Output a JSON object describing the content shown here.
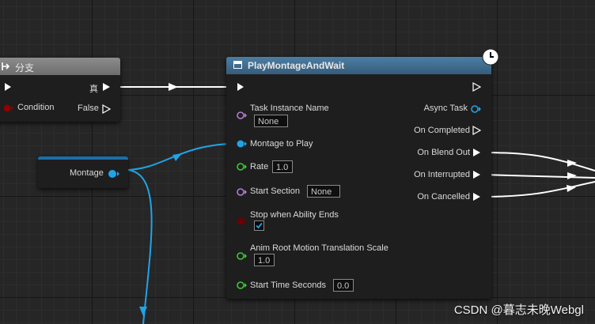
{
  "branch_node": {
    "title": "分支",
    "exec_out_true": "真",
    "condition_label": "Condition",
    "false_label": "False"
  },
  "variable_node": {
    "label": "Montage"
  },
  "play_node": {
    "title": "PlayMontageAndWait",
    "inputs": {
      "task_instance_name": {
        "label": "Task Instance Name",
        "value": "None"
      },
      "montage_to_play": {
        "label": "Montage to Play"
      },
      "rate": {
        "label": "Rate",
        "value": "1.0"
      },
      "start_section": {
        "label": "Start Section",
        "value": "None"
      },
      "stop_when_ability_ends": {
        "label": "Stop when Ability Ends",
        "checked": true
      },
      "anim_root_motion": {
        "label": "Anim Root Motion Translation Scale",
        "value": "1.0"
      },
      "start_time_seconds": {
        "label": "Start Time Seconds",
        "value": "0.0"
      }
    },
    "outputs": {
      "async_task": "Async Task",
      "on_completed": "On Completed",
      "on_blend_out": "On Blend Out",
      "on_interrupted": "On Interrupted",
      "on_cancelled": "On Cancelled"
    }
  },
  "colors": {
    "exec_wire": "#ffffff",
    "object_pin": "#1fa4e8",
    "name_pin": "#b17fd4",
    "float_pin": "#3ec93a",
    "bool_pin": "#8f0000",
    "play_header": "#426c8e",
    "branch_header": "#7a7a7a"
  },
  "watermark": "CSDN @暮志未晚Webgl"
}
